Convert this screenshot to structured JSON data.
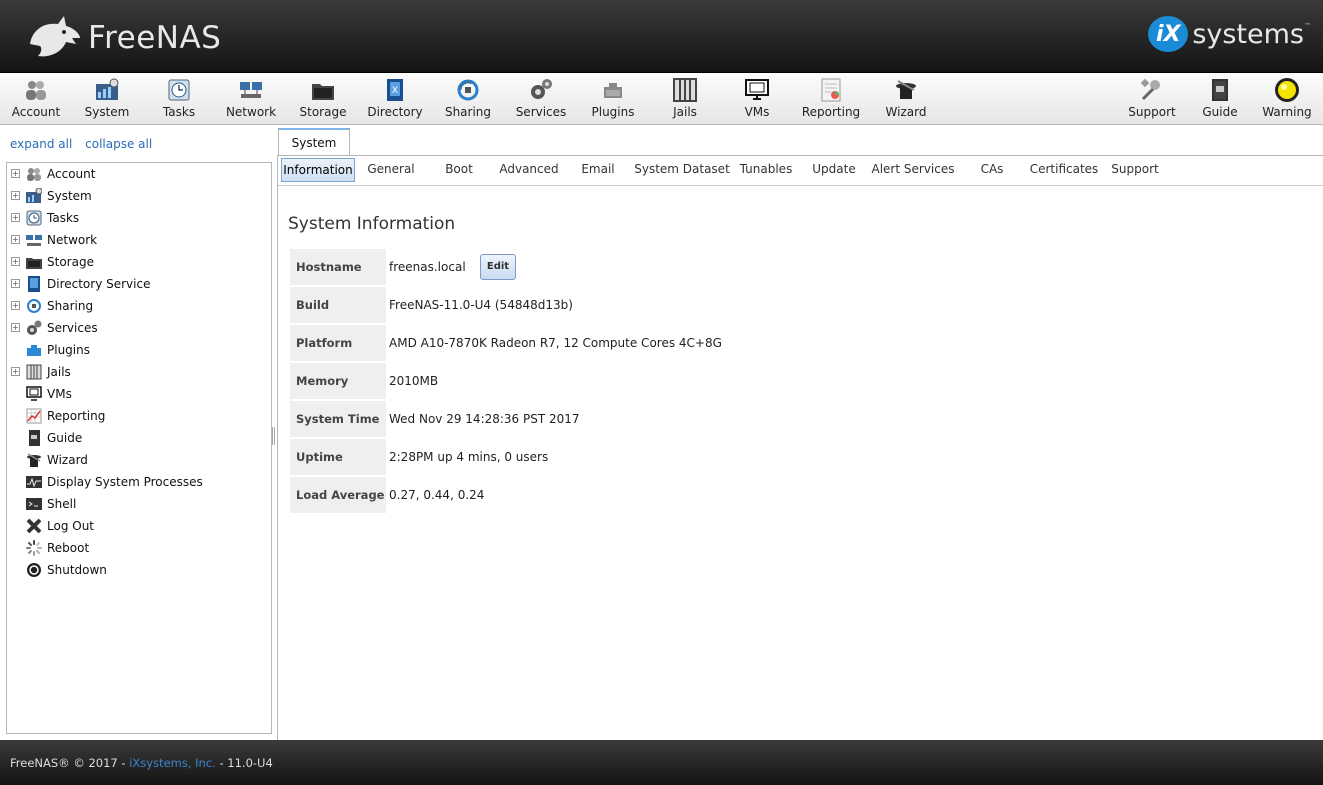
{
  "header": {
    "logo_text": "FreeNAS",
    "tm": "™",
    "ix_badge": "iX",
    "ix_text": "systems",
    "ix_tm": "™"
  },
  "toolbar": {
    "left": [
      {
        "label": "Account",
        "icon": "users-icon"
      },
      {
        "label": "System",
        "icon": "system-icon"
      },
      {
        "label": "Tasks",
        "icon": "tasks-icon"
      },
      {
        "label": "Network",
        "icon": "network-icon"
      },
      {
        "label": "Storage",
        "icon": "storage-icon"
      },
      {
        "label": "Directory",
        "icon": "directory-icon"
      },
      {
        "label": "Sharing",
        "icon": "sharing-icon"
      },
      {
        "label": "Services",
        "icon": "services-icon"
      },
      {
        "label": "Plugins",
        "icon": "plugins-icon"
      },
      {
        "label": "Jails",
        "icon": "jails-icon"
      },
      {
        "label": "VMs",
        "icon": "vms-icon"
      },
      {
        "label": "Reporting",
        "icon": "reporting-icon"
      },
      {
        "label": "Wizard",
        "icon": "wizard-icon"
      }
    ],
    "right": [
      {
        "label": "Support",
        "icon": "support-icon"
      },
      {
        "label": "Guide",
        "icon": "guide-icon"
      },
      {
        "label": "Warning",
        "icon": "warning-light-icon"
      }
    ]
  },
  "sidebar": {
    "expand_all": "expand all",
    "collapse_all": "collapse all",
    "items": [
      {
        "label": "Account",
        "expandable": true
      },
      {
        "label": "System",
        "expandable": true
      },
      {
        "label": "Tasks",
        "expandable": true
      },
      {
        "label": "Network",
        "expandable": true
      },
      {
        "label": "Storage",
        "expandable": true
      },
      {
        "label": "Directory Service",
        "expandable": true
      },
      {
        "label": "Sharing",
        "expandable": true
      },
      {
        "label": "Services",
        "expandable": true
      },
      {
        "label": "Plugins",
        "expandable": false
      },
      {
        "label": "Jails",
        "expandable": true
      },
      {
        "label": "VMs",
        "expandable": false
      },
      {
        "label": "Reporting",
        "expandable": false
      },
      {
        "label": "Guide",
        "expandable": false
      },
      {
        "label": "Wizard",
        "expandable": false
      },
      {
        "label": "Display System Processes",
        "expandable": false
      },
      {
        "label": "Shell",
        "expandable": false
      },
      {
        "label": "Log Out",
        "expandable": false
      },
      {
        "label": "Reboot",
        "expandable": false
      },
      {
        "label": "Shutdown",
        "expandable": false
      }
    ]
  },
  "main": {
    "outer_tab": "System",
    "subtabs": [
      "Information",
      "General",
      "Boot",
      "Advanced",
      "Email",
      "System Dataset",
      "Tunables",
      "Update",
      "Alert Services",
      "CAs",
      "Certificates",
      "Support"
    ],
    "active_subtab": "Information",
    "title": "System Information",
    "edit_label": "Edit",
    "rows": [
      {
        "key": "Hostname",
        "value": "freenas.local"
      },
      {
        "key": "Build",
        "value": "FreeNAS-11.0-U4 (54848d13b)"
      },
      {
        "key": "Platform",
        "value": "AMD A10-7870K Radeon R7, 12 Compute Cores 4C+8G"
      },
      {
        "key": "Memory",
        "value": "2010MB"
      },
      {
        "key": "System Time",
        "value": "Wed Nov 29 14:28:36 PST 2017"
      },
      {
        "key": "Uptime",
        "value": "2:28PM up 4 mins, 0 users"
      },
      {
        "key": "Load Average",
        "value": "0.27, 0.44, 0.24"
      }
    ]
  },
  "footer": {
    "prefix": "FreeNAS® © 2017 - ",
    "link": "iXsystems, Inc.",
    "suffix": " - 11.0-U4"
  },
  "colors": {
    "accent": "#2a6db5",
    "warning_light": "#f5e400",
    "header_bg": "#1e1e1e"
  }
}
